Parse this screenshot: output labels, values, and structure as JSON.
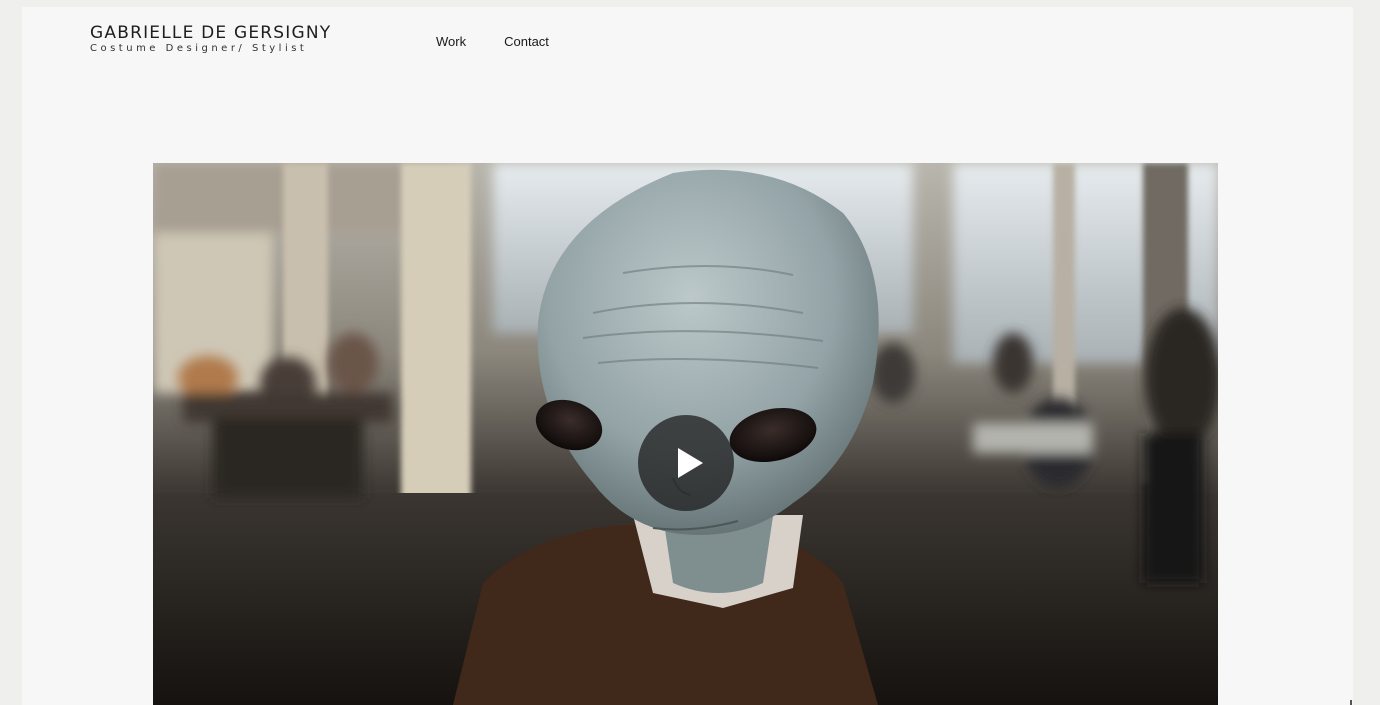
{
  "header": {
    "brand_title": "GABRIELLE DE GERSIGNY",
    "brand_subtitle": "Costume Designer/ Stylist"
  },
  "nav": {
    "items": [
      {
        "label": "Work"
      },
      {
        "label": "Contact"
      }
    ]
  },
  "video": {
    "play_icon": "play-icon"
  },
  "colors": {
    "page_background": "#f7f7f7",
    "outer_background": "#efefee",
    "text": "#1e1e1e",
    "play_button": "#1e1e1e"
  }
}
